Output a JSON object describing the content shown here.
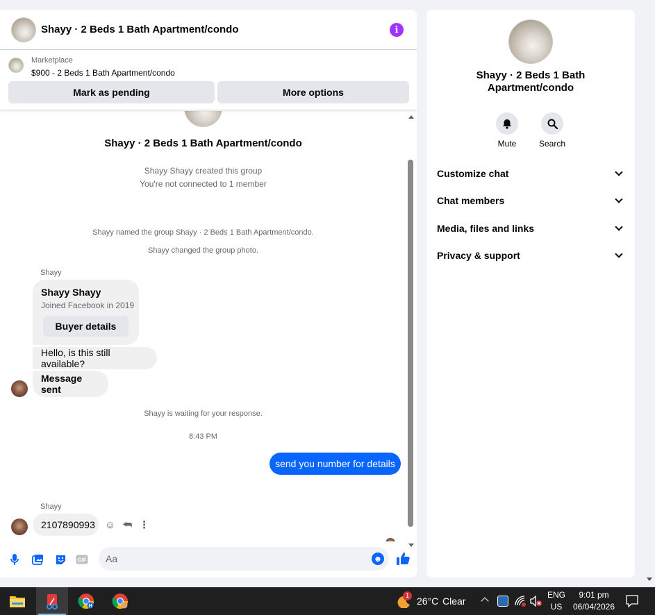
{
  "chat": {
    "title": "Shayy · 2 Beds 1 Bath Apartment/condo",
    "marketplace": {
      "label": "Marketplace",
      "listing": "$900 - 2 Beds 1 Bath Apartment/condo",
      "pending_label": "Mark as pending",
      "more_label": "More options"
    },
    "system": {
      "group_title": "Shayy · 2 Beds 1 Bath Apartment/condo",
      "created": "Shayy Shayy created this group",
      "connected": "You're not connected to 1 member",
      "named": "Shayy named the group Shayy · 2 Beds 1 Bath Apartment/condo.",
      "photo": "Shayy changed the group photo.",
      "waiting": "Shayy is waiting for your response.",
      "time": "8:43 PM"
    },
    "card": {
      "sender": "Shayy",
      "name": "Shayy Shayy",
      "joined": "Joined Facebook in 2019",
      "button": "Buyer details"
    },
    "messages": {
      "m1": "Hello, is this still available?",
      "m2": "Message sent",
      "out": "send you number for details",
      "sender2": "Shayy",
      "m3": "2107890993"
    },
    "composer": {
      "placeholder": "Aa"
    }
  },
  "side": {
    "title": "Shayy · 2 Beds 1 Bath Apartment/condo",
    "mute": "Mute",
    "search": "Search",
    "sections": [
      "Customize chat",
      "Chat members",
      "Media, files and links",
      "Privacy & support"
    ]
  },
  "taskbar": {
    "weather_temp": "26°C",
    "weather_desc": "Clear",
    "weather_badge": "1",
    "lang_top": "ENG",
    "lang_bottom": "US",
    "time": "9:01 pm",
    "date": "06/04/2026"
  },
  "colors": {
    "accent": "#0866ff",
    "info": "#a033ff",
    "taskbar": "#1f1f1f"
  }
}
